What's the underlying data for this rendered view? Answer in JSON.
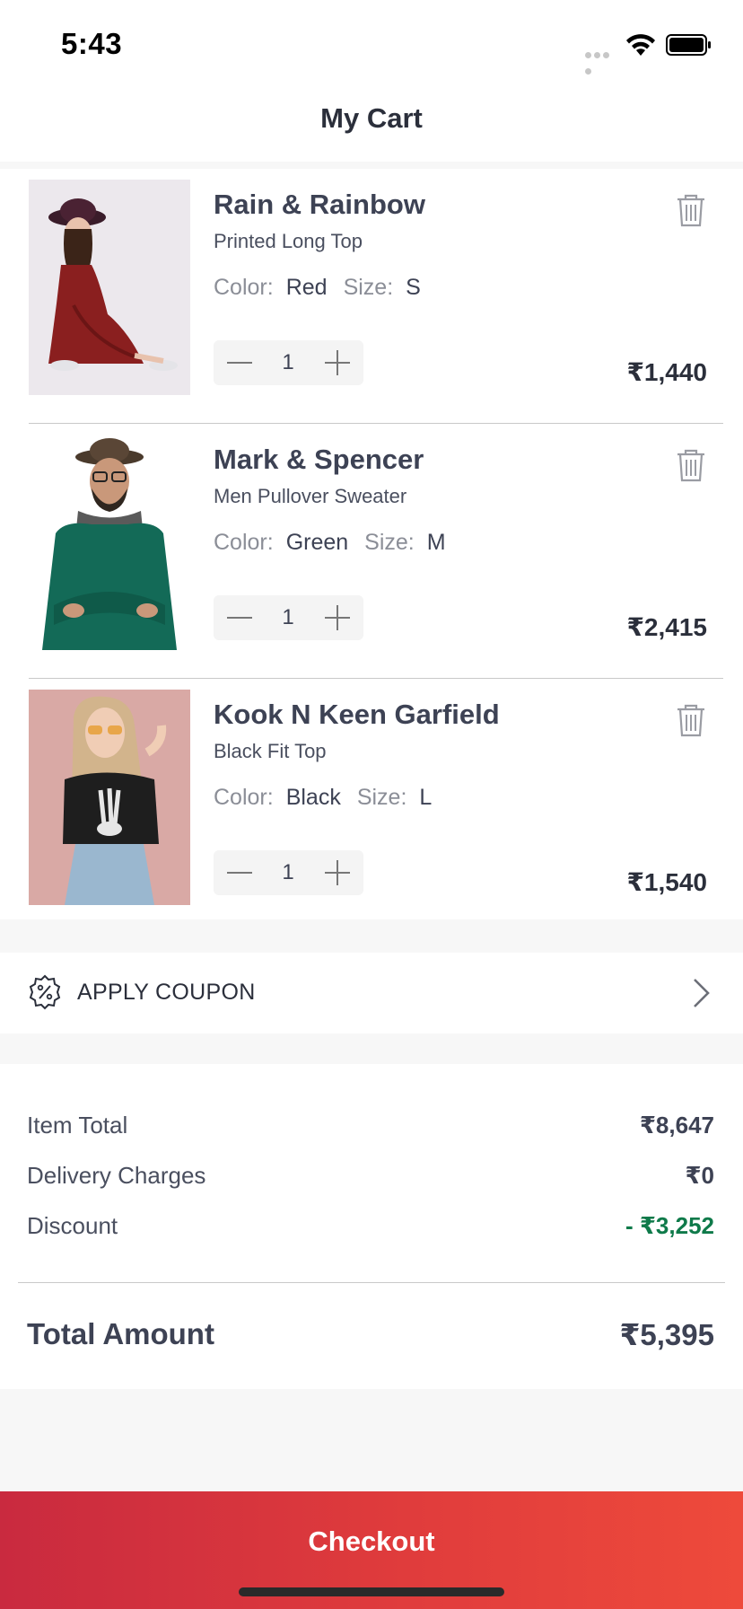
{
  "status_bar": {
    "time": "5:43"
  },
  "header": {
    "title": "My Cart"
  },
  "cart": {
    "items": [
      {
        "brand": "Rain & Rainbow",
        "subtitle": "Printed Long Top",
        "color_label": "Color:",
        "color": "Red",
        "size_label": "Size:",
        "size": "S",
        "quantity": "1",
        "price": "₹1,440"
      },
      {
        "brand": "Mark & Spencer",
        "subtitle": "Men Pullover Sweater",
        "color_label": "Color:",
        "color": "Green",
        "size_label": "Size:",
        "size": "M",
        "quantity": "1",
        "price": "₹2,415"
      },
      {
        "brand": "Kook N Keen Garfield",
        "subtitle": "Black Fit Top",
        "color_label": "Color:",
        "color": "Black",
        "size_label": "Size:",
        "size": "L",
        "quantity": "1",
        "price": "₹1,540"
      }
    ]
  },
  "coupon": {
    "label": "APPLY COUPON"
  },
  "summary": {
    "item_total_label": "Item Total",
    "item_total": "₹8,647",
    "delivery_label": "Delivery Charges",
    "delivery": "₹0",
    "discount_label": "Discount",
    "discount": "- ₹3,252",
    "total_label": "Total Amount",
    "total": "₹5,395"
  },
  "checkout": {
    "label": "Checkout"
  },
  "colors": {
    "accent": "#e03c3c",
    "discount_green": "#0f7a4a",
    "text": "#3d4254"
  }
}
